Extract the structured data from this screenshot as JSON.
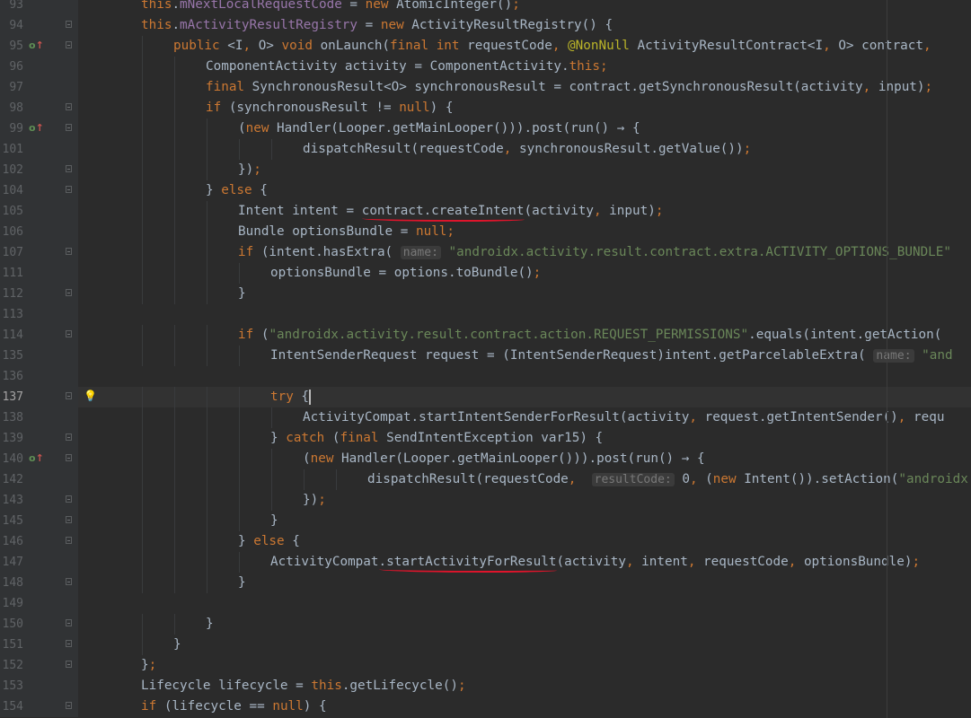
{
  "editor": {
    "lines": [
      {
        "n": "93",
        "indent": 1,
        "code": "this.mNextLocalRequestCode = new AtomicInteger();",
        "fold": "none"
      },
      {
        "n": "94",
        "indent": 1,
        "code": "this.mActivityResultRegistry = new ActivityResultRegistry() {",
        "fold": "open"
      },
      {
        "n": "95",
        "indent": 2,
        "code": "public <I, O> void onLaunch(final int requestCode, @NonNull ActivityResultContract<I, O> contract,",
        "fold": "open",
        "marker": true
      },
      {
        "n": "96",
        "indent": 3,
        "code": "ComponentActivity activity = ComponentActivity.this;",
        "fold": "none"
      },
      {
        "n": "97",
        "indent": 3,
        "code": "final SynchronousResult<O> synchronousResult = contract.getSynchronousResult(activity, input);",
        "fold": "none"
      },
      {
        "n": "98",
        "indent": 3,
        "code": "if (synchronousResult != null) {",
        "fold": "open"
      },
      {
        "n": "99",
        "indent": 4,
        "code": "(new Handler(Looper.getMainLooper())).post(run() → {",
        "fold": "open",
        "marker": true
      },
      {
        "n": "101",
        "indent": 6,
        "code": "dispatchResult(requestCode, synchronousResult.getValue());",
        "fold": "none"
      },
      {
        "n": "102",
        "indent": 4,
        "code": "});",
        "fold": "close"
      },
      {
        "n": "104",
        "indent": 3,
        "code": "} else {",
        "fold": "close"
      },
      {
        "n": "105",
        "indent": 4,
        "code": "Intent intent = contract.createIntent(activity, input);",
        "fold": "none"
      },
      {
        "n": "106",
        "indent": 4,
        "code": "Bundle optionsBundle = null;",
        "fold": "none"
      },
      {
        "n": "107",
        "indent": 4,
        "code": "if (intent.hasExtra( name: \"androidx.activity.result.contract.extra.ACTIVITY_OPTIONS_BUNDLE\"",
        "fold": "open"
      },
      {
        "n": "111",
        "indent": 5,
        "code": "optionsBundle = options.toBundle();",
        "fold": "none"
      },
      {
        "n": "112",
        "indent": 4,
        "code": "}",
        "fold": "close"
      },
      {
        "n": "113",
        "indent": 0,
        "code": "",
        "fold": "none"
      },
      {
        "n": "114",
        "indent": 4,
        "code": "if (\"androidx.activity.result.contract.action.REQUEST_PERMISSIONS\".equals(intent.getAction(",
        "fold": "open"
      },
      {
        "n": "135",
        "indent": 5,
        "code": "IntentSenderRequest request = (IntentSenderRequest)intent.getParcelableExtra( name: \"and",
        "fold": "none"
      },
      {
        "n": "136",
        "indent": 0,
        "code": "",
        "fold": "none"
      },
      {
        "n": "137",
        "indent": 5,
        "code": "try {",
        "fold": "open",
        "current": true,
        "bulb": true
      },
      {
        "n": "138",
        "indent": 6,
        "code": "ActivityCompat.startIntentSenderForResult(activity, request.getIntentSender(), requ",
        "fold": "none"
      },
      {
        "n": "139",
        "indent": 5,
        "code": "} catch (final SendIntentException var15) {",
        "fold": "open"
      },
      {
        "n": "140",
        "indent": 6,
        "code": "(new Handler(Looper.getMainLooper())).post(run() → {",
        "fold": "open",
        "marker": true
      },
      {
        "n": "142",
        "indent": 8,
        "code": "dispatchResult(requestCode,  resultCode: 0, (new Intent()).setAction(\"androidx",
        "fold": "none"
      },
      {
        "n": "143",
        "indent": 6,
        "code": "});",
        "fold": "close"
      },
      {
        "n": "145",
        "indent": 5,
        "code": "}",
        "fold": "close"
      },
      {
        "n": "146",
        "indent": 4,
        "code": "} else {",
        "fold": "open"
      },
      {
        "n": "147",
        "indent": 5,
        "code": "ActivityCompat.startActivityForResult(activity, intent, requestCode, optionsBundle);",
        "fold": "none"
      },
      {
        "n": "148",
        "indent": 4,
        "code": "}",
        "fold": "close"
      },
      {
        "n": "149",
        "indent": 0,
        "code": "",
        "fold": "none"
      },
      {
        "n": "150",
        "indent": 3,
        "code": "}",
        "fold": "close"
      },
      {
        "n": "151",
        "indent": 2,
        "code": "}",
        "fold": "close"
      },
      {
        "n": "152",
        "indent": 1,
        "code": "};",
        "fold": "close"
      },
      {
        "n": "153",
        "indent": 1,
        "code": "Lifecycle lifecycle = this.getLifecycle();",
        "fold": "none"
      },
      {
        "n": "154",
        "indent": 1,
        "code": "if (lifecycle == null) {",
        "fold": "open"
      }
    ],
    "annotations": [
      {
        "line_index": 10,
        "text": "contract.createIntent"
      },
      {
        "line_index": 27,
        "text": ".startActivityForResult"
      }
    ],
    "colors": {
      "background": "#2b2b2b",
      "gutter": "#313335",
      "keyword": "#cc7832",
      "string": "#6a8759",
      "field": "#9876aa",
      "text": "#a9b7c6",
      "underline": "#e0142b"
    }
  }
}
